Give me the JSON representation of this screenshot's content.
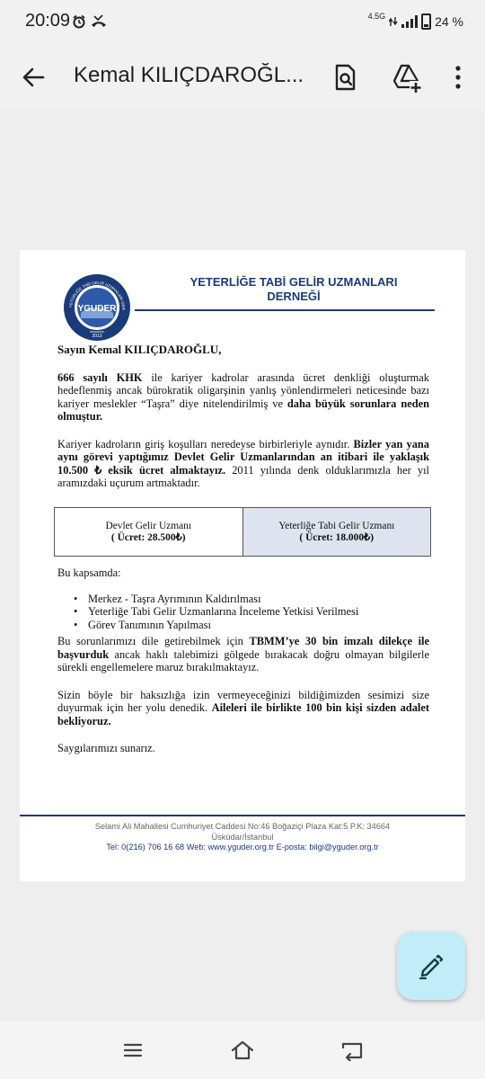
{
  "status_bar": {
    "time": "20:09",
    "network": "4.5G",
    "battery": "24 %"
  },
  "app_bar": {
    "title": "Kemal KILIÇDAROĞL..."
  },
  "letterhead": {
    "logo_text": "YGUDER",
    "logo_arc_text": "YETERLİĞE TABİ GELİR UZMANLARI DERNEĞİ",
    "logo_year": "2013",
    "title_line1": "YETERLİĞE TABİ GELİR UZMANLARI",
    "title_line2": "DERNEĞİ"
  },
  "letter": {
    "greeting": "Sayın Kemal KILIÇDAROĞLU,",
    "p1_b1": "666 sayılı KHK",
    "p1_t1": " ile kariyer kadrolar arasında ücret denkliği oluşturmak hedeflenmiş ancak bürokratik oligarşinin yanlış yönlendirmeleri neticesinde bazı kariyer meslekler “Taşra” diye nitelendirilmiş ve ",
    "p1_b2": "daha büyük sorunlara neden olmuştur.",
    "p2_t1": "Kariyer kadroların giriş koşulları neredeyse birbirleriyle aynıdır. ",
    "p2_b1": "Bizler yan yana aynı görevi yaptığımız Devlet Gelir Uzmanlarından an itibari ile yaklaşık 10.500 ₺ eksik ücret almaktayız.",
    "p2_t2": " 2011 yılında denk olduklarımızla her yıl aramızdaki uçurum artmaktadır.",
    "p3": "Bu kapsamda:",
    "bullets": [
      "Merkez - Taşra Ayrımının Kaldırılması",
      "Yeterliğe Tabi Gelir Uzmanlarına İnceleme Yetkisi Verilmesi",
      "Görev Tanımının Yapılması"
    ],
    "p4_t1": "Bu sorunlarımızı dile getirebilmek için ",
    "p4_b1": "TBMM’ye 30 bin imzalı dilekçe ile başvurduk",
    "p4_t2": " ancak haklı talebimizi gölgede bırakacak doğru olmayan bilgilerle sürekli engellemelere maruz bırakılmaktayız.",
    "p5_t1": "Sizin böyle bir haksızlığa izin vermeyeceğinizi bildiğimizden sesimizi size duyurmak için her yolu denedik. ",
    "p5_b1": "Aileleri ile birlikte 100 bin kişi sizden adalet bekliyoruz.",
    "closing": "Saygılarımızı sunarız."
  },
  "salary_table": {
    "col1_title": "Devlet Gelir Uzmanı",
    "col1_value": "( Ücret: 28.500₺)",
    "col2_title": "Yeterliğe Tabi Gelir Uzmanı",
    "col2_value": "( Ücret: 18.000₺)"
  },
  "footer": {
    "address_line1": "Selami Ali Mahallesi Cumhuriyet Caddesi No:46 Boğaziçi Plaza Kat:5 P.K: 34664",
    "address_line2": "Üsküdar/İstanbul",
    "contact": "Tel: 0(216) 706 16 68 Web: www.yguder.org.tr E-posta: bilgi@yguder.org.tr"
  },
  "icons": {
    "back": "arrow-back-icon",
    "search_doc": "document-search-icon",
    "drive_add": "drive-add-icon",
    "more": "more-vert-icon",
    "edit": "edit-pen-icon"
  },
  "colors": {
    "letterhead_navy": "#1b3a7a",
    "table_highlight": "#dde4ef",
    "fab_bg": "#c2ecf8"
  }
}
